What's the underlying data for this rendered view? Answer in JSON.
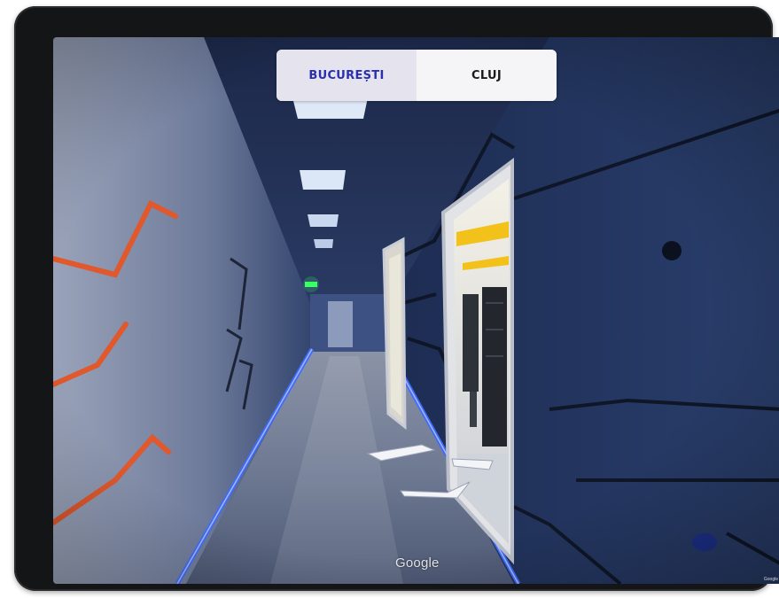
{
  "location_switch": {
    "options": [
      {
        "label": "BUCUREȘTI",
        "active": true
      },
      {
        "label": "CLUJ",
        "active": false
      }
    ]
  },
  "viewer": {
    "watermark": "Google",
    "corner_credit": "Google",
    "navigation_arrows": [
      "forward-arrow-icon",
      "left-arrow-icon",
      "right-arrow-icon"
    ]
  },
  "colors": {
    "accent_active_text": "#2a2fae",
    "corridor_led": "#3f6bff",
    "wall_blue": "#24385f",
    "orange_graphics": "#e0582c",
    "exit_sign": "#3cff6a",
    "server_cable_yellow": "#f2c21a"
  }
}
